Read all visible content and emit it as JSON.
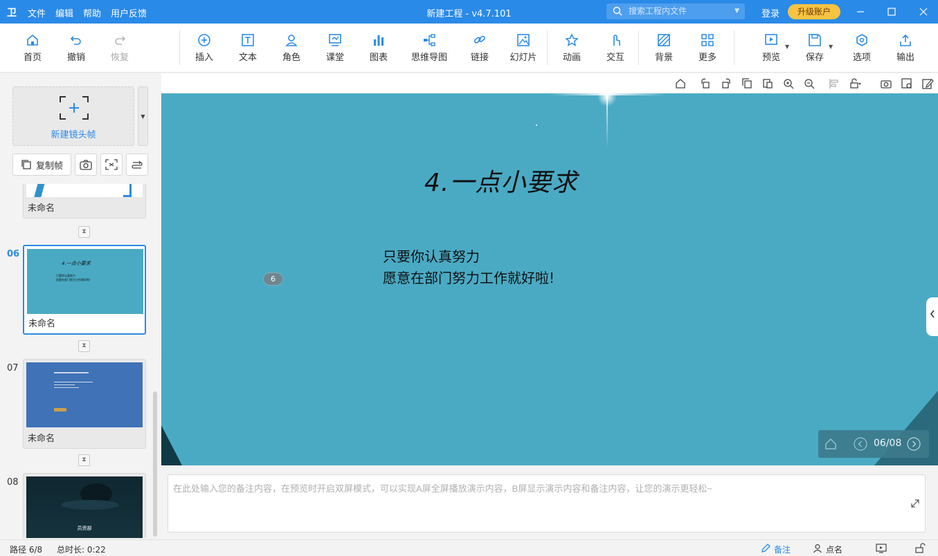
{
  "titlebar": {
    "logo": "卫",
    "menu": [
      "文件",
      "编辑",
      "帮助",
      "用户反馈"
    ],
    "title": "新建工程 - v4.7.101",
    "search_placeholder": "搜索工程内文件",
    "login": "登录",
    "upgrade": "升级账户"
  },
  "toolbar": {
    "home": "首页",
    "undo": "撤销",
    "redo": "恢复",
    "insert": "插入",
    "text": "文本",
    "role": "角色",
    "class": "课堂",
    "chart": "图表",
    "mindmap": "思维导图",
    "link": "链接",
    "slides": "幻灯片",
    "animation": "动画",
    "interact": "交互",
    "background": "背景",
    "more": "更多",
    "preview": "预览",
    "save": "保存",
    "options": "选项",
    "export": "输出"
  },
  "leftpanel": {
    "new_frame": "新建镜头帧",
    "copy_frame": "复制帧",
    "frames": [
      {
        "num": "",
        "name": "未命名"
      },
      {
        "num": "06",
        "name": "未命名",
        "preview_title": "4.一点小要求",
        "preview_l1": "只要你认真努力",
        "preview_l2": "愿意在部门努力工作就好啦!"
      },
      {
        "num": "07",
        "name": "未命名"
      },
      {
        "num": "08",
        "name": "",
        "preview_caption": "员资部"
      }
    ]
  },
  "slide": {
    "title": "4.一点小要求",
    "line1": "只要你认真努力",
    "line2": "愿意在部门努力工作就好啦!",
    "badge": "6",
    "page_indicator": "06/08",
    "bg_color": "#4aaac4"
  },
  "notes": {
    "placeholder": "在此处输入您的备注内容，在预览时开启双屏模式，可以实现A屏全屏播放演示内容，B屏显示演示内容和备注内容，让您的演示更轻松~"
  },
  "statusbar": {
    "path": "路径 6/8",
    "duration": "总时长: 0:22",
    "notes": "备注",
    "rollcall": "点名"
  }
}
